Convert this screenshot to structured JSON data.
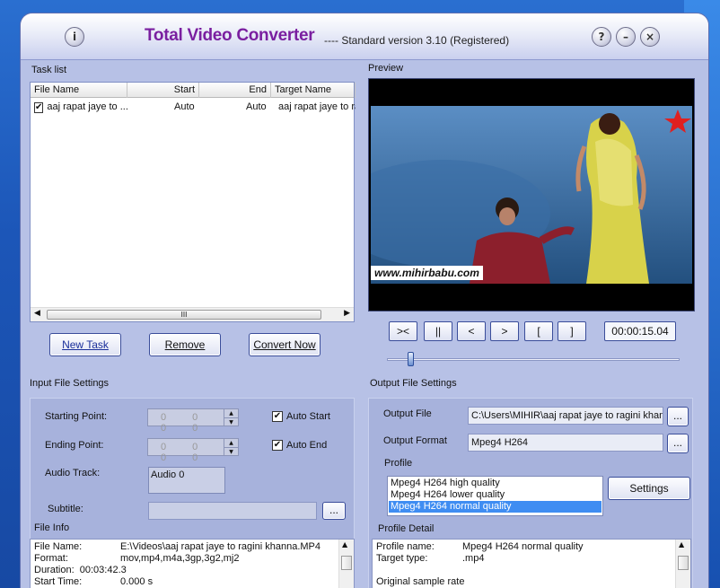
{
  "window": {
    "title": "Total Video Converter",
    "version": "----  Standard version 3.10 (Registered)",
    "info_glyph": "i",
    "help_glyph": "?",
    "minimize_glyph": "–",
    "close_glyph": "×"
  },
  "task_list": {
    "label": "Task list",
    "columns": [
      "File Name",
      "Start",
      "End",
      "Target Name"
    ],
    "rows": [
      {
        "checked": "✔",
        "file_name": "aaj rapat jaye to ...",
        "start": "Auto",
        "end": "Auto",
        "target_name": "aaj rapat jaye to ra"
      }
    ],
    "scroll_thumb": "III"
  },
  "task_buttons": {
    "new_task": "New Task",
    "remove": "Remove",
    "convert_now": "Convert Now"
  },
  "preview": {
    "label": "Preview",
    "watermark": "www.mihirbabu.com",
    "controls": [
      "><",
      "||",
      "<",
      ">",
      "[",
      "]"
    ],
    "time": "00:00:15.04",
    "seek_position_fraction": 0.08
  },
  "input_settings": {
    "label": "Input File Settings",
    "starting_point_label": "Starting Point:",
    "starting_point_value": "0 0 0 0",
    "ending_point_label": "Ending Point:",
    "ending_point_value": "0 0 0 0",
    "auto_start_label": "Auto Start",
    "auto_start_check": "✔",
    "auto_end_label": "Auto End",
    "auto_end_check": "✔",
    "audio_track_label": "Audio Track:",
    "audio_track_value": "Audio 0",
    "subtitle_label": "Subtitle:",
    "subtitle_value": "",
    "browse_label": "...",
    "file_info_label": "File Info",
    "file_info": [
      {
        "key": "File Name:",
        "value": "E:\\Videos\\aaj rapat jaye to ragini khanna.MP4"
      },
      {
        "key": "Format:",
        "value": "mov,mp4,m4a,3gp,3g2,mj2"
      },
      {
        "key": "Duration:",
        "value": "00:03:42.3"
      },
      {
        "key": "Start Time:",
        "value": "0.000  s"
      }
    ]
  },
  "output_settings": {
    "label": "Output File Settings",
    "output_file_label": "Output File",
    "output_file_value": "C:\\Users\\MIHIR\\aaj rapat jaye to ragini khan",
    "output_format_label": "Output Format",
    "output_format_value": "Mpeg4 H264",
    "browse_label": "...",
    "profile_label": "Profile",
    "profiles": [
      "Mpeg4 H264 high quality",
      "Mpeg4 H264 lower quality",
      "Mpeg4 H264 normal quality"
    ],
    "selected_profile": "Mpeg4 H264 normal quality",
    "settings_button": "Settings",
    "profile_detail_label": "Profile Detail",
    "profile_detail": [
      {
        "key": "Profile name:",
        "value": "Mpeg4 H264 normal quality"
      },
      {
        "key": "Target type:",
        "value": ".mp4"
      },
      {
        "key": "Original sample rate",
        "value": ""
      }
    ]
  }
}
